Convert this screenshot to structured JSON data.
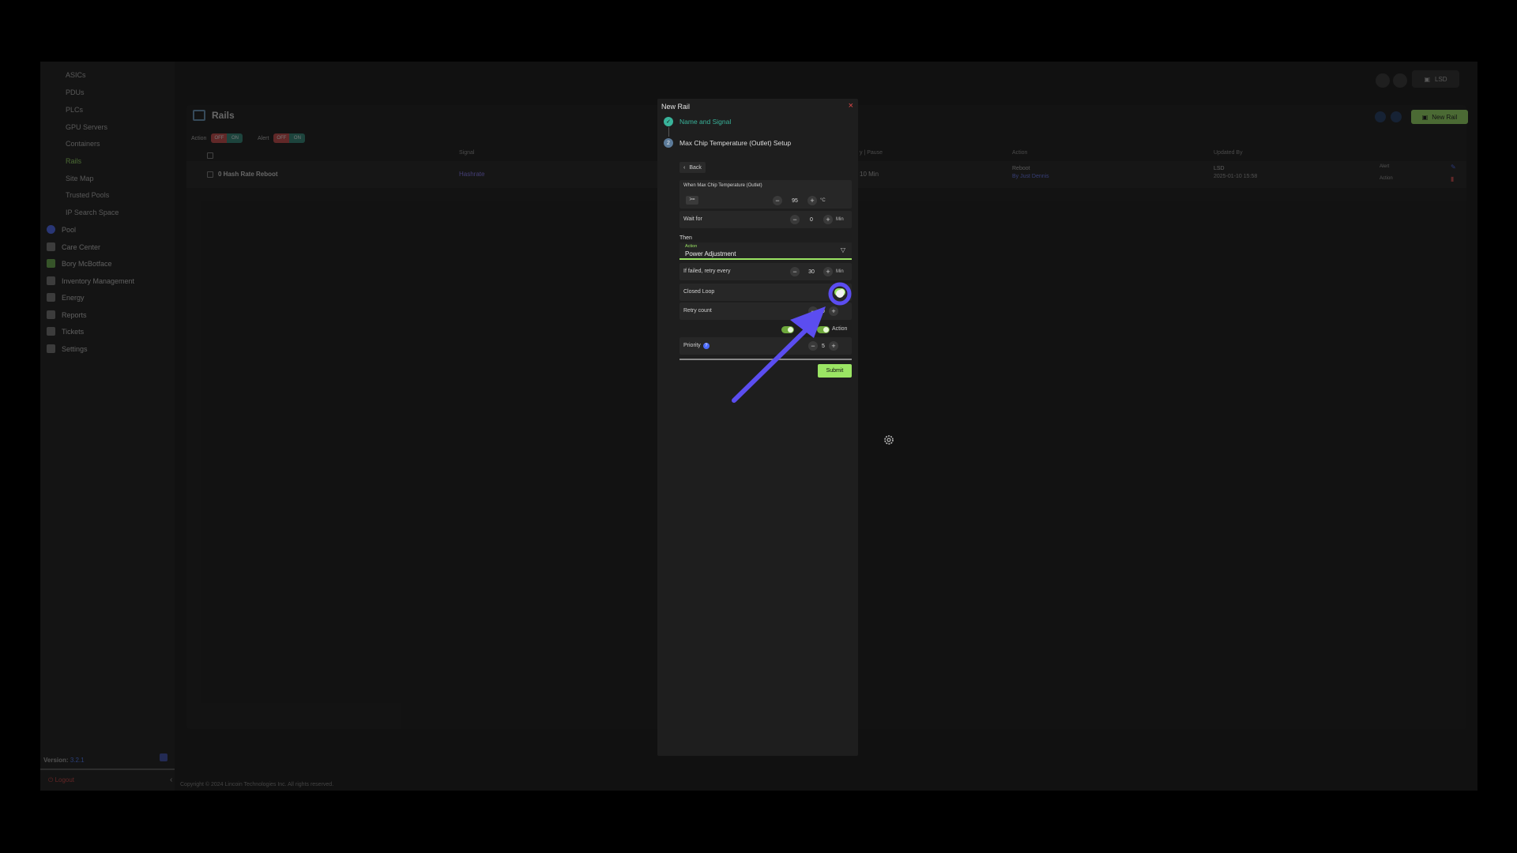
{
  "sidebar": {
    "sub_items": [
      "ASICs",
      "PDUs",
      "PLCs",
      "GPU Servers",
      "Containers",
      "Rails",
      "Site Map",
      "Trusted Pools",
      "IP Search Space"
    ],
    "active_sub_item": "Rails",
    "main_items": [
      {
        "label": "Pool",
        "icon": "pool-icon"
      },
      {
        "label": "Care Center",
        "icon": "care-center-icon"
      },
      {
        "label": "Bory McBotface",
        "icon": "bot-icon"
      },
      {
        "label": "Inventory Management",
        "icon": "inventory-icon"
      },
      {
        "label": "Energy",
        "icon": "energy-icon"
      },
      {
        "label": "Reports",
        "icon": "reports-icon"
      },
      {
        "label": "Tickets",
        "icon": "tickets-icon"
      },
      {
        "label": "Settings",
        "icon": "settings-icon"
      }
    ],
    "version_label": "Version:",
    "version_value": "3.2.1",
    "logout_label": "Logout"
  },
  "footer": "Copyright © 2024 Lincoin Technologies Inc. All rights reserved.",
  "topbar": {
    "user_label": "LSD"
  },
  "rails_page": {
    "title": "Rails",
    "filters": [
      {
        "label": "Action",
        "off": "OFF",
        "on": "ON"
      },
      {
        "label": "Alert",
        "off": "OFF",
        "on": "ON"
      }
    ],
    "new_rail_button": "New Rail",
    "columns": {
      "signal": "Signal",
      "delay": "y | Pause",
      "action": "Action",
      "updated_by": "Updated By"
    },
    "rows": [
      {
        "name": "0 Hash Rate Reboot",
        "signal": "Hashrate",
        "delay": "10 Min",
        "action": "Reboot",
        "action_by": "By Just Dennis",
        "updated_by": "LSD",
        "updated_at": "2025-01-10 15:58",
        "alert_label": "Alert",
        "action_label": "Action"
      }
    ]
  },
  "modal": {
    "title": "New Rail",
    "close": "×",
    "steps": [
      {
        "label": "Name and Signal",
        "marker": "✓"
      },
      {
        "label": "Max Chip Temperature (Outlet) Setup",
        "marker": "2"
      }
    ],
    "back_label": "Back",
    "condition": {
      "label": "When Max Chip Temperature (Outlet)",
      "operator": ">=",
      "value": "95",
      "unit": "°C"
    },
    "wait": {
      "label": "Wait for",
      "value": "0",
      "unit": "Min"
    },
    "then_label": "Then",
    "action_select": {
      "label": "Action",
      "value": "Power Adjustment"
    },
    "retry_interval": {
      "label": "If failed, retry every",
      "value": "30",
      "unit": "Min"
    },
    "closed_loop": {
      "label": "Closed Loop",
      "enabled": true
    },
    "retry_count": {
      "label": "Retry count",
      "value": "0"
    },
    "notify_toggles": {
      "second_label": "Action"
    },
    "priority": {
      "label": "Priority",
      "value": "5",
      "help": "?"
    },
    "submit_label": "Submit"
  },
  "annotation": {
    "arrow_color": "#5b4df0"
  }
}
